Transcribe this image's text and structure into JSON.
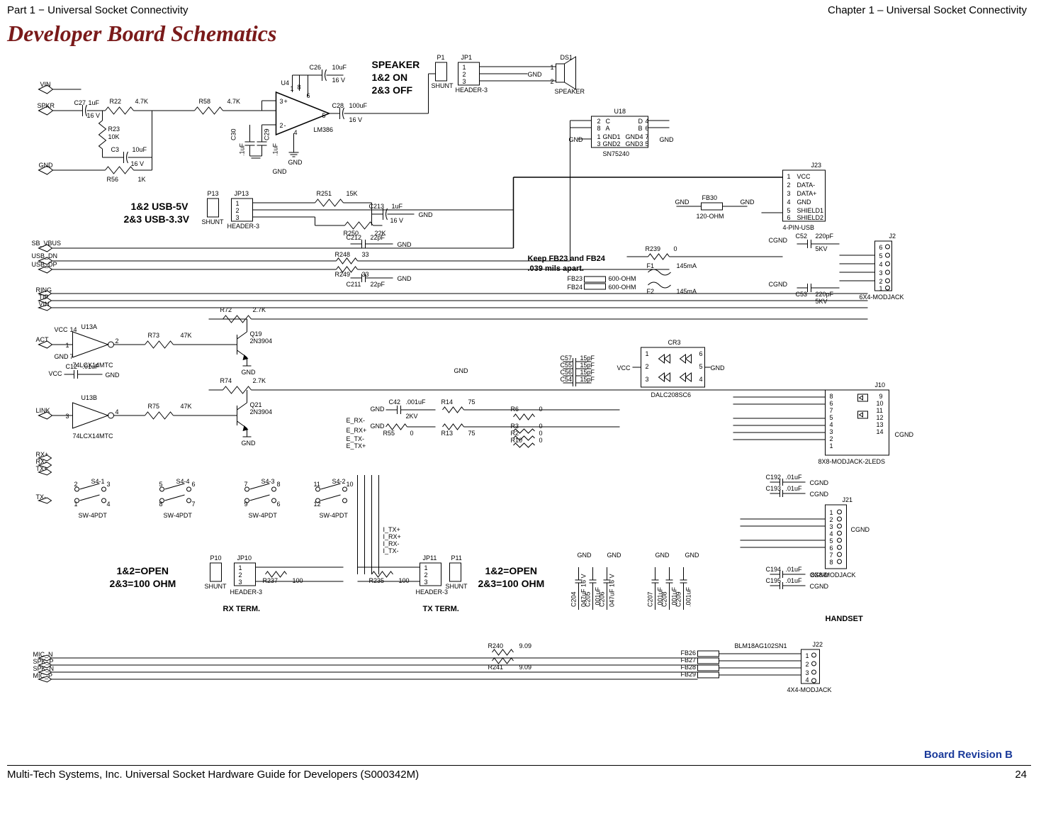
{
  "header": {
    "left": "Part 1 − Universal Socket Connectivity",
    "right": "Chapter 1 – Universal Socket Connectivity"
  },
  "section_title": "Developer Board Schematics",
  "revision": "Board Revision B",
  "footer": {
    "left": "Multi-Tech Systems, Inc. Universal Socket Hardware Guide for Developers (S000342M)",
    "page": "24"
  },
  "labels": {
    "vin": "VIN",
    "spkr": "SPKR",
    "gnd": "GND",
    "sb_vbus": "SB_VBUS",
    "usb_dn": "USB_DN",
    "usb_dp": "USB_DP",
    "ring": "RING",
    "tip": "TIP",
    "vin2": "VIN",
    "act": "ACT",
    "link": "LINK",
    "rxp": "RX+",
    "rxm": "RX-",
    "txp": "TX+",
    "txm": "TX-",
    "mic_n": "MIC_N",
    "spk_p": "SPK_P",
    "spk_n": "SPK_N",
    "mic_p": "MIC_P",
    "vcc": "VCC",
    "cgnd": "CGND",
    "speaker_title": "SPEAKER",
    "speaker_on": "1&2 ON",
    "speaker_off": "2&3 OFF",
    "usb5v": "1&2 USB-5V",
    "usb33v": "2&3 USB-3.3V",
    "keep_fb": "Keep FB23 and FB24",
    "keep_fb2": ".039 mils apart.",
    "open12": "1&2=OPEN",
    "ohm23": "2&3=100 OHM",
    "rx_term": "RX TERM.",
    "tx_term": "TX TERM.",
    "handset": "HANDSET",
    "e_rxm": "E_RX-",
    "e_rxp": "E_RX+",
    "e_txm": "E_TX-",
    "e_txp": "E_TX+",
    "i_txp": "I_TX+",
    "i_rxp": "I_RX+",
    "i_rxm": "I_RX-",
    "i_txm": "I_TX-",
    "data_minus": "DATA-",
    "data_plus": "DATA+",
    "shield1": "SHIELD1",
    "shield2": "SHIELD2"
  },
  "parts": {
    "c26": "C26",
    "c26v": "10uF",
    "c26v2": "16 V",
    "c27": "C27",
    "c27v": "1uF",
    "c27v2": "16 V",
    "r22": "R22",
    "r22v": "4.7K",
    "r58": "R58",
    "r58v": "4.7K",
    "r23": "R23",
    "r23v": "10K",
    "c3": "C3",
    "c3v": "10uF",
    "c3v2": "16 V",
    "r56": "R56",
    "r56v": "1K",
    "c30": "C30",
    "c30v": ".1uF",
    "c29": "C29",
    "c29v": ".1uF",
    "u4": "U4",
    "lm386": "LM386",
    "c28": "C28",
    "c28v": "100uF",
    "c28v2": "16 V",
    "p1": "P1",
    "jp1": "JP1",
    "shunt": "SHUNT",
    "hdr3": "HEADER-3",
    "ds1": "DS1",
    "speaker": "SPEAKER",
    "p13": "P13",
    "jp13": "JP13",
    "r251": "R251",
    "r251v": "15K",
    "c213": "C213",
    "c213v": "1uF",
    "c213v2": "16 V",
    "r250": "R250",
    "r250v": "22K",
    "c212": "C212",
    "c212v": "22pF",
    "c211": "C211",
    "c211v": "22pF",
    "r248": "R248",
    "r248v": "33",
    "r249": "R249",
    "r249v": "33",
    "u18": "U18",
    "sn75240": "SN75240",
    "gnd1": "GND1",
    "gnd2": "GND2",
    "gnd3": "GND3",
    "gnd4": "GND4",
    "fb30": "FB30",
    "fb30v": "120-OHM",
    "j23": "J23",
    "4pinusb": "4-PIN-USB",
    "c52": "C52",
    "c52v": "220pF",
    "c52v2": "5KV",
    "c53": "C53",
    "c53v": "220pF",
    "c53v2": "5KV",
    "r239": "R239",
    "r239v": "0",
    "f1": "F1",
    "f1v": "145mA",
    "f2": "F2",
    "f2v": "145mA",
    "fb23": "FB23",
    "fb23v": "600-OHM",
    "fb24": "FB24",
    "fb24v": "600-OHM",
    "j2": "J2",
    "6x4mj": "6X4-MODJACK",
    "u13a": "U13A",
    "u13b": "U13B",
    "lcx": "74LCX14MTC",
    "r73": "R73",
    "r73v": "47K",
    "r72": "R72",
    "r72v": "2.7K",
    "q19": "Q19",
    "q21": "Q21",
    "n3904": "2N3904",
    "c12": "C12",
    "c12v": ".01uF",
    "r75": "R75",
    "r75v": "47K",
    "r74": "R74",
    "r74v": "2.7K",
    "c42": "C42",
    "c42v": ".001uF",
    "c42v2": "2KV",
    "r14": "R14",
    "r14v": "75",
    "r55": "R55",
    "r55v": "0",
    "r13": "R13",
    "r13v": "75",
    "r6": "R6",
    "r6v": "0",
    "r3": "R3",
    "r3v": "0",
    "r2": "R2",
    "r2v": "0",
    "r10": "R10",
    "r10v": "0",
    "c57": "C57",
    "c55": "C55",
    "c56": "C56",
    "c54": "C54",
    "c15pf": "15pF",
    "cr3": "CR3",
    "dalc": "DALC208SC6",
    "j10": "J10",
    "j10t": "8X8-MODJACK-2LEDS",
    "s4_1": "S4-1",
    "s4_4": "S4-4",
    "s4_3": "S4-3",
    "s4_2": "S4-2",
    "sw4pdt": "SW-4PDT",
    "p10": "P10",
    "jp10": "JP10",
    "p11": "P11",
    "jp11": "JP11",
    "r237": "R237",
    "r237v": "100",
    "r235": "R235",
    "r235v": "100",
    "c192": "C192",
    "c193": "C193",
    "c194": "C194",
    "c195": "C195",
    "c01uf": ".01uF",
    "j21": "J21",
    "j21t": "8X8-MODJACK",
    "c204": "C204",
    "c205": "C205",
    "c206": "C206",
    "c207": "C207",
    "c208": "C208",
    "c209": "C209",
    "c047": "047uF 16 V",
    "c001": ".001uF",
    "fb26": "FB26",
    "fb27": "FB27",
    "fb28": "FB28",
    "fb29": "FB29",
    "blm": "BLM18AG102SN1",
    "j22": "J22",
    "j22t": "4X4-MODJACK",
    "r240": "R240",
    "r241": "R241",
    "r909": "9.09"
  }
}
